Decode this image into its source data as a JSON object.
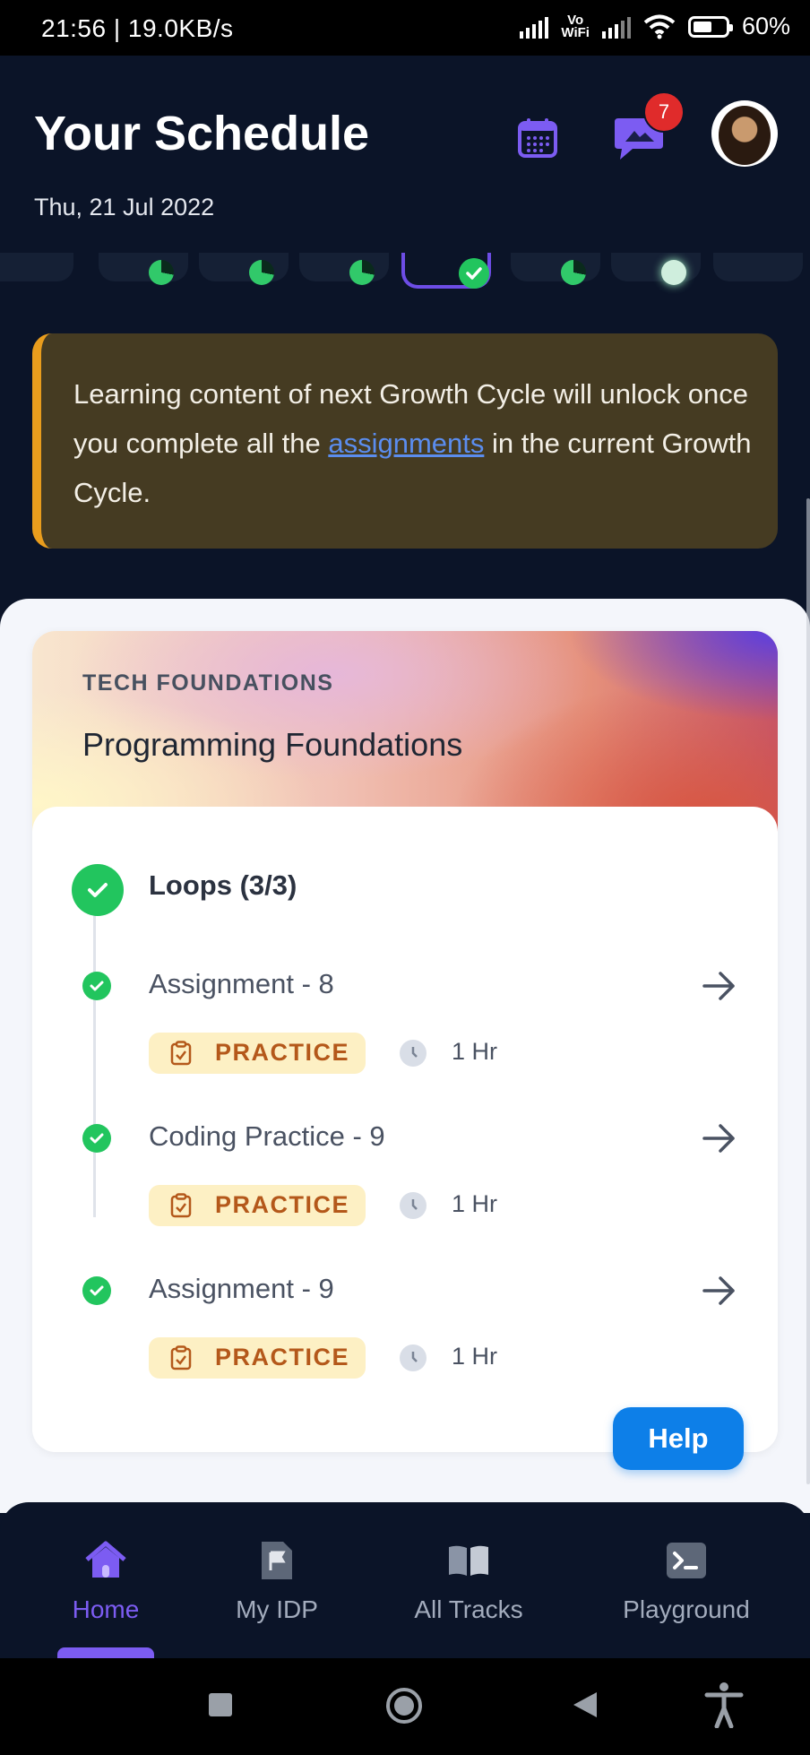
{
  "status_bar": {
    "time": "21:56 | 19.0KB/s",
    "vowifi": "Vo\nWiFi",
    "battery": "60%",
    "battery_level": 0.6
  },
  "header": {
    "title": "Your Schedule",
    "date": "Thu, 21 Jul 2022",
    "notification_count": "7"
  },
  "banner": {
    "text_before": "Learning content of next Growth Cycle will unlock once you complete all the ",
    "link": "assignments",
    "text_after": "  in the current Growth Cycle."
  },
  "card": {
    "category": "TECH FOUNDATIONS",
    "course": "Programming Foundations",
    "module": "Loops (3/3)",
    "items": [
      {
        "name": "Assignment - 8",
        "tag": "PRACTICE",
        "duration": "1 Hr"
      },
      {
        "name": "Coding Practice - 9",
        "tag": "PRACTICE",
        "duration": "1 Hr"
      },
      {
        "name": "Assignment - 9",
        "tag": "PRACTICE",
        "duration": "1 Hr"
      }
    ]
  },
  "help_label": "Help",
  "nav": {
    "items": [
      {
        "label": "Home",
        "icon": "home-icon",
        "active": true
      },
      {
        "label": "My IDP",
        "icon": "flag-document-icon"
      },
      {
        "label": "All Tracks",
        "icon": "open-book-icon"
      },
      {
        "label": "Playground",
        "icon": "terminal-icon"
      }
    ]
  },
  "colors": {
    "accent": "#7c5cf2",
    "success": "#22c55e",
    "warning": "#e99d1d",
    "help": "#0d7fe8",
    "link": "#5b8dee"
  }
}
